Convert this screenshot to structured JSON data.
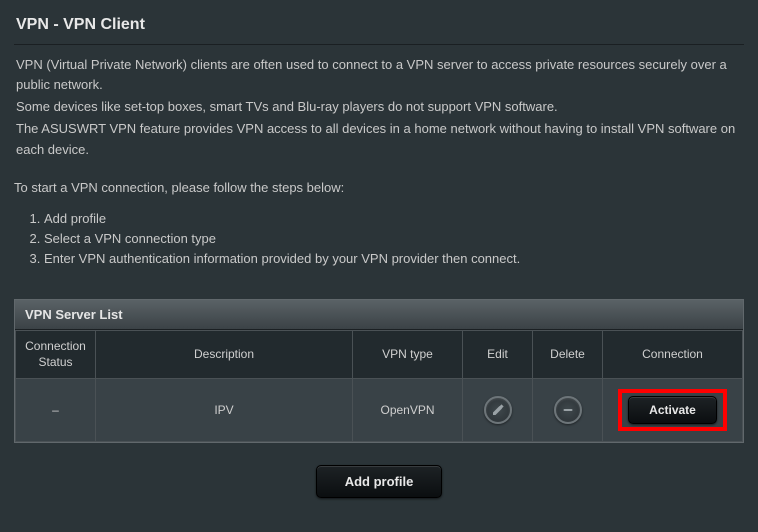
{
  "title": "VPN - VPN Client",
  "intro": {
    "p1": "VPN (Virtual Private Network) clients are often used to connect to a VPN server to access private resources securely over a public network.",
    "p2": "Some devices like set-top boxes, smart TVs and Blu-ray players do not support VPN software.",
    "p3": "The ASUSWRT VPN feature provides VPN access to all devices in a home network without having to install VPN software on each device."
  },
  "steps_lead": "To start a VPN connection, please follow the steps below:",
  "steps": {
    "s1": "Add profile",
    "s2": "Select a VPN connection type",
    "s3": "Enter VPN authentication information provided by your VPN provider then connect."
  },
  "panel_title": "VPN Server List",
  "columns": {
    "status": "Connection Status",
    "description": "Description",
    "vpntype": "VPN type",
    "edit": "Edit",
    "delete": "Delete",
    "connection": "Connection"
  },
  "row": {
    "status": "–",
    "description": "IPV",
    "vpntype": "OpenVPN",
    "activate": "Activate"
  },
  "buttons": {
    "add_profile": "Add profile"
  }
}
